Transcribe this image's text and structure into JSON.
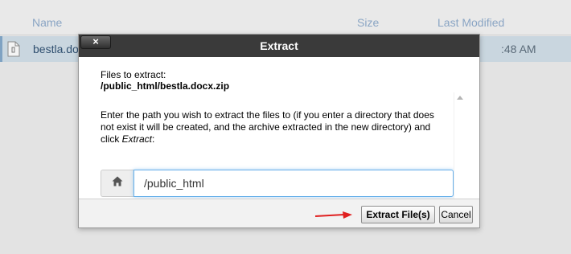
{
  "file_list": {
    "columns": {
      "name": "Name",
      "size": "Size",
      "modified": "Last Modified"
    },
    "row": {
      "name": "bestla.docx.zip",
      "modified_partial": ":48 AM"
    }
  },
  "dialog": {
    "title": "Extract",
    "close_label": "×",
    "files_label": "Files to extract:",
    "files_path": "/public_html/bestla.docx.zip",
    "instructions_before": "Enter the path you wish to extract the files to (if you enter a directory that does not exist it will be created, and the archive extracted in the new directory) and click ",
    "instructions_em": "Extract",
    "instructions_after": ":",
    "path_value": "/public_html",
    "extract_button": "Extract File(s)",
    "cancel_button": "Cancel"
  },
  "colors": {
    "titlebar": "#3a3a3a",
    "annotation_arrow": "#e02020",
    "input_focus": "#66afe9"
  },
  "icons": [
    "zip-file-icon",
    "home-icon",
    "close-icon",
    "red-arrow-icon"
  ]
}
